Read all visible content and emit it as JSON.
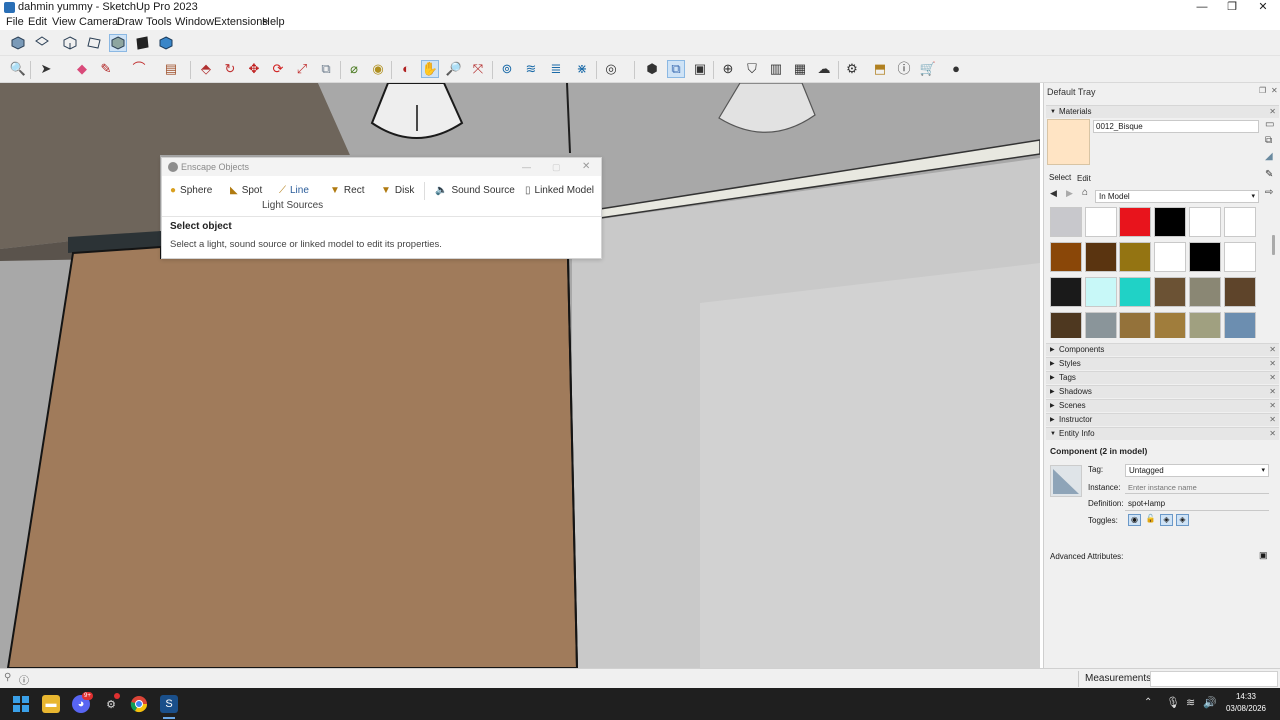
{
  "window": {
    "title": "dahmin yummy - SketchUp Pro 2023",
    "controls": [
      "minimize-icon",
      "restore-icon",
      "close-icon"
    ]
  },
  "menu": [
    "File",
    "Edit",
    "View",
    "Camera",
    "Draw",
    "Tools",
    "Window",
    "Extensions",
    "Help"
  ],
  "enscape": {
    "title": "Enscape Objects",
    "buttons": {
      "sphere": "Sphere",
      "spot": "Spot",
      "line": "Line",
      "rect": "Rect",
      "disk": "Disk",
      "sound": "Sound Source",
      "linked": "Linked Model"
    },
    "group_label": "Light Sources",
    "heading": "Select object",
    "description": "Select a light, sound source or linked model to edit its properties."
  },
  "tray": {
    "title": "Default Tray",
    "materials": {
      "section": "Materials",
      "material_name": "0012_Bisque",
      "preview_color": "#ffe4c4",
      "tab_select": "Select",
      "tab_edit": "Edit",
      "collection": "In Model",
      "swatches": [
        "#c8c8cc",
        "#ffffff",
        "#e8141c",
        "#000000",
        "#ffffff",
        "#ffffff",
        "#8a4708",
        "#5a3410",
        "#947412",
        "#ffffff",
        "#000000",
        "#ffffff",
        "#1a1a1a",
        "#c8f8f8",
        "#20d2c6",
        "#6b5234",
        "#8a8774",
        "#5e442a",
        "#4e3820",
        "#8a959a",
        "#94723a",
        "#a07d3c",
        "#a0a080",
        "#6c8eb0"
      ]
    },
    "collapsed_sections": [
      "Components",
      "Styles",
      "Tags",
      "Shadows",
      "Scenes",
      "Instructor"
    ],
    "entity_info": {
      "section": "Entity Info",
      "heading": "Component (2 in model)",
      "tag_label": "Tag:",
      "tag_value": "Untagged",
      "instance_label": "Instance:",
      "instance_placeholder": "Enter instance name",
      "definition_label": "Definition:",
      "definition_value": "spot+lamp",
      "toggles_label": "Toggles:",
      "advanced": "Advanced Attributes:"
    }
  },
  "statusbar": {
    "measurements": "Measurements"
  },
  "taskbar": {
    "time": "14:33",
    "date": "03/08/2026",
    "notification_count": "9+"
  }
}
